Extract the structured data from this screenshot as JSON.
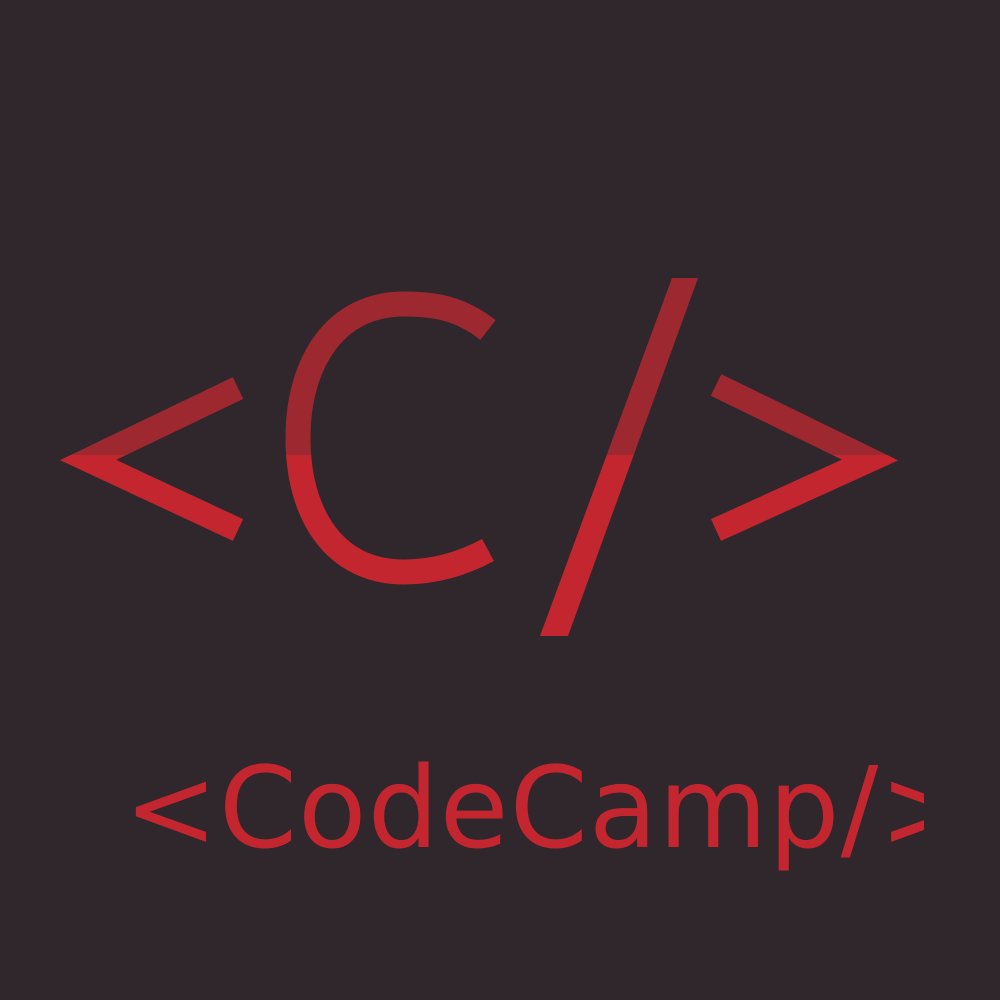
{
  "logo": {
    "mark_text": "<C/>",
    "wordmark": "<CodeCamp/>",
    "colors": {
      "background": "#2f272c",
      "mark_upper": "#9e2830",
      "mark_lower": "#c4262f",
      "wordmark": "#c4262f"
    }
  }
}
